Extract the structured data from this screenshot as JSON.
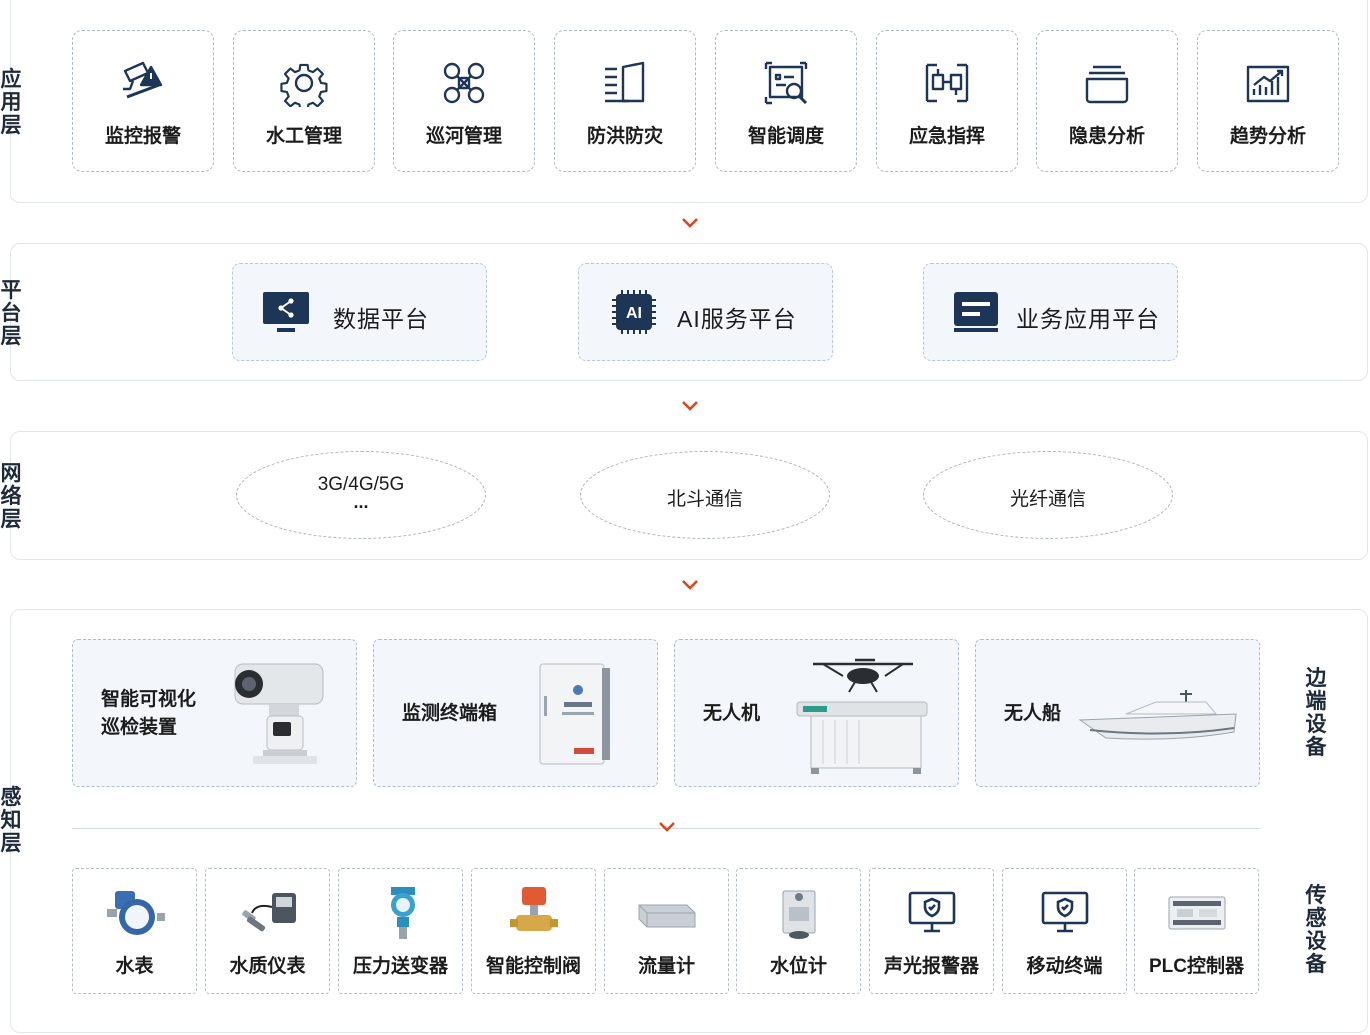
{
  "layers": {
    "application": {
      "label": [
        "应",
        "用",
        "层"
      ]
    },
    "platform": {
      "label": [
        "平",
        "台",
        "层"
      ]
    },
    "network": {
      "label": [
        "网",
        "络",
        "层"
      ]
    },
    "perception": {
      "label": [
        "感",
        "知",
        "层"
      ]
    }
  },
  "application_items": [
    {
      "label": "监控报警",
      "icon": "alarm-monitor-icon"
    },
    {
      "label": "水工管理",
      "icon": "gear-icon"
    },
    {
      "label": "巡河管理",
      "icon": "drone-icon"
    },
    {
      "label": "防洪防灾",
      "icon": "flood-gate-icon"
    },
    {
      "label": "智能调度",
      "icon": "dispatch-search-icon"
    },
    {
      "label": "应急指挥",
      "icon": "emergency-command-icon"
    },
    {
      "label": "隐患分析",
      "icon": "folder-icon"
    },
    {
      "label": "趋势分析",
      "icon": "trend-chart-icon"
    }
  ],
  "platform_items": [
    {
      "label": "数据平台",
      "icon": "share-monitor-icon"
    },
    {
      "label": "AI服务平台",
      "icon": "ai-chip-icon",
      "icon_text": "AI"
    },
    {
      "label": "业务应用平台",
      "icon": "app-window-icon"
    }
  ],
  "network_items": [
    {
      "label": "3G/4G/5G",
      "sub": "..."
    },
    {
      "label": "北斗通信"
    },
    {
      "label": "光纤通信"
    }
  ],
  "edge_devices": {
    "group_label": [
      "边",
      "端",
      "设",
      "备"
    ],
    "items": [
      {
        "label_lines": [
          "智能可视化",
          "巡检装置"
        ],
        "image": "ptz-camera"
      },
      {
        "label_lines": [
          "监测终端箱"
        ],
        "image": "terminal-box"
      },
      {
        "label_lines": [
          "无人机"
        ],
        "image": "drone-with-hangar"
      },
      {
        "label_lines": [
          "无人船"
        ],
        "image": "unmanned-boat"
      }
    ]
  },
  "sensor_devices": {
    "group_label": [
      "传",
      "感",
      "设",
      "备"
    ],
    "items": [
      {
        "label": "水表",
        "image": "water-meter"
      },
      {
        "label": "水质仪表",
        "image": "water-quality-meter"
      },
      {
        "label": "压力送变器",
        "image": "pressure-transmitter"
      },
      {
        "label": "智能控制阀",
        "image": "control-valve"
      },
      {
        "label": "流量计",
        "image": "flow-meter"
      },
      {
        "label": "水位计",
        "image": "level-meter"
      },
      {
        "label": "声光报警器",
        "image": "alarm-monitor"
      },
      {
        "label": "移动终端",
        "image": "mobile-terminal"
      },
      {
        "label": "PLC控制器",
        "image": "plc-controller"
      }
    ]
  },
  "colors": {
    "icon_navy": "#1d3557",
    "arrow": "#d9481c",
    "card_bg": "#f3f7fc"
  }
}
